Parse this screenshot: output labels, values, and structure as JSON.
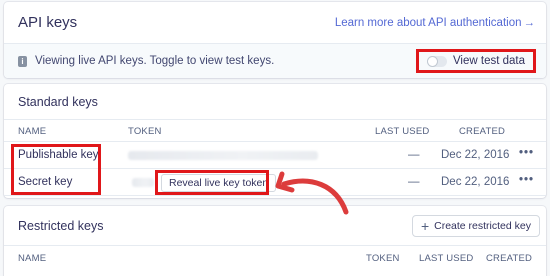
{
  "api_card": {
    "title": "API keys",
    "learn_link": "Learn more about API authentication",
    "learn_arrow": "→",
    "info_icon": "i",
    "info_text": "Viewing live API keys. Toggle to view test keys.",
    "toggle_label": "View test data",
    "toggle_on": false
  },
  "standard": {
    "title": "Standard keys",
    "columns": {
      "name": "NAME",
      "token": "TOKEN",
      "last_used": "LAST USED",
      "created": "CREATED"
    },
    "rows": [
      {
        "name": "Publishable key",
        "last_used": "—",
        "created": "Dec 22, 2016",
        "menu": "•••"
      },
      {
        "name": "Secret key",
        "reveal_label": "Reveal live key token",
        "last_used": "—",
        "created": "Dec 22, 2016",
        "menu": "•••"
      }
    ]
  },
  "restricted": {
    "title": "Restricted keys",
    "create_icon": "+",
    "create_label": "Create restricted key",
    "columns": {
      "name": "NAME",
      "token": "TOKEN",
      "last_used": "LAST USED",
      "created": "CREATED"
    }
  },
  "colors": {
    "highlight": "#e0171a",
    "arrow": "#dc3c3c",
    "link": "#5469d4"
  }
}
